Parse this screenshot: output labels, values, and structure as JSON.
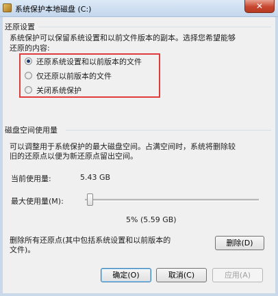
{
  "window": {
    "title": "系统保护本地磁盘 (C:)",
    "close_glyph": "✕"
  },
  "restore_settings": {
    "group_label": "还原设置",
    "description_line1": "系统保护可以保留系统设置和以前文件版本的副本。选择您希望能够",
    "description_line2": "还原的内容:",
    "options": [
      {
        "label": "还原系统设置和以前版本的文件",
        "checked": true
      },
      {
        "label": "仅还原以前版本的文件",
        "checked": false
      },
      {
        "label": "关闭系统保护",
        "checked": false
      }
    ]
  },
  "disk_usage": {
    "group_label": "磁盘空间使用量",
    "description_line1": "可以调整用于系统保护的最大磁盘空间。占满空间时，系统将删除较",
    "description_line2": "旧的还原点以便为新还原点留出空间。",
    "current_usage_label": "当前使用量:",
    "current_usage_value": "5.43 GB",
    "max_usage_label": "最大使用量(M):",
    "max_usage_percent": 5,
    "max_usage_text": "5% (5.59 GB)",
    "delete_text_line1": "删除所有还原点(其中包括系统设置和以前版本的",
    "delete_text_line2": "文件)。",
    "delete_button": "删除(D)"
  },
  "buttons": {
    "ok": "确定(O)",
    "cancel": "取消(C)",
    "apply": "应用(A)"
  }
}
